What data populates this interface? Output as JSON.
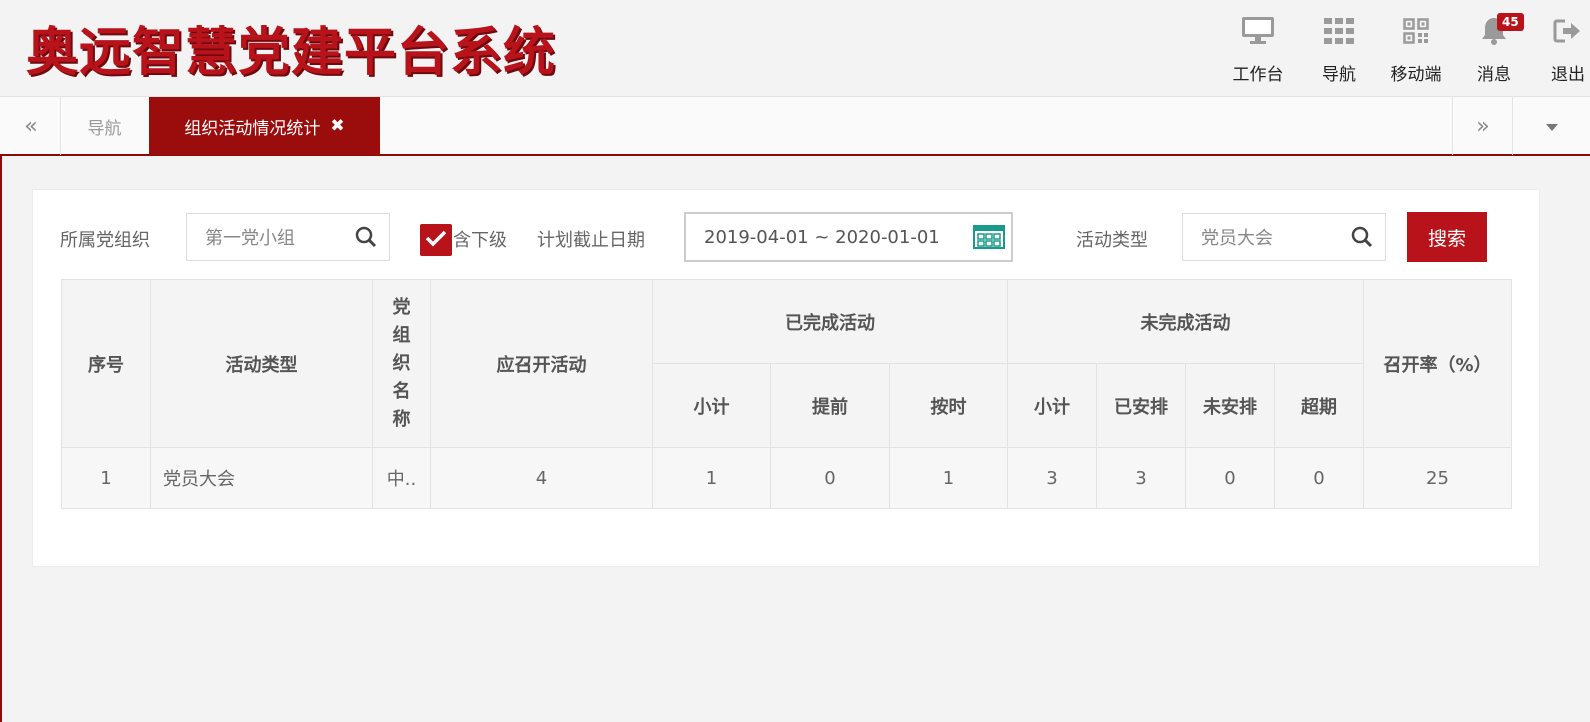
{
  "app": {
    "title": "奥远智慧党建平台系统"
  },
  "header": {
    "tools": [
      {
        "label": "工作台",
        "icon": "monitor-icon"
      },
      {
        "label": "导航",
        "icon": "grid-icon"
      },
      {
        "label": "移动端",
        "icon": "qrcode-icon"
      },
      {
        "label": "消息",
        "icon": "bell-icon",
        "badge": "45"
      },
      {
        "label": "退出",
        "icon": "logout-icon"
      }
    ]
  },
  "tabs": {
    "prev": "«",
    "next": "»",
    "nav_label": "导航",
    "active_label": "组织活动情况统计",
    "close": "✖"
  },
  "filters": {
    "org_label": "所属党组织",
    "org_value": "第一党小组",
    "include_sub_label": "含下级",
    "include_sub_checked": true,
    "date_label": "计划截止日期",
    "date_value": "2019-04-01 ~ 2020-01-01",
    "activity_type_label": "活动类型",
    "activity_type_value": "党员大会",
    "search_button": "搜索"
  },
  "table": {
    "headers": {
      "index": "序号",
      "activity_type": "活动类型",
      "org_name": [
        "党",
        "组",
        "织",
        "名",
        "称"
      ],
      "should_hold": "应召开活动",
      "completed": "已完成活动",
      "incomplete": "未完成活动",
      "rate": "召开率（%）",
      "completed_sub": [
        "小计",
        "提前",
        "按时"
      ],
      "incomplete_sub": [
        "小计",
        "已安排",
        "未安排",
        "超期"
      ]
    },
    "rows": [
      {
        "index": "1",
        "activity_type": "党员大会",
        "org_name": "中..",
        "should_hold": "4",
        "completed_total": "1",
        "completed_early": "0",
        "completed_ontime": "1",
        "incomplete_total": "3",
        "incomplete_arranged": "3",
        "incomplete_unarranged": "0",
        "incomplete_overdue": "0",
        "rate": "25"
      }
    ]
  },
  "colors": {
    "brand": "#b8121a",
    "tab_active": "#9b0d0d",
    "bar": "#8b0a0a"
  }
}
